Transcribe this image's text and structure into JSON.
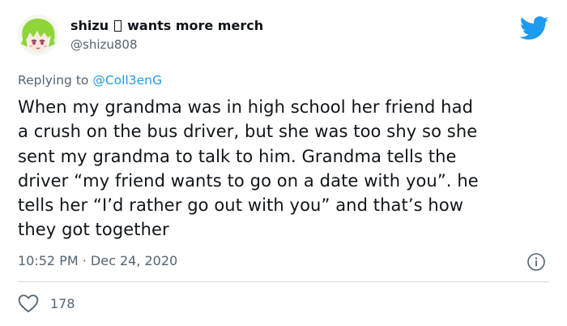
{
  "author": {
    "display_name_part1": "shizu",
    "display_name_part2": "wants more merch",
    "handle": "@shizu808"
  },
  "reply": {
    "prefix": "Replying to",
    "mention": "@Coll3enG"
  },
  "tweet": {
    "lines": [
      "When my grandma was in high school her friend had",
      "a crush on the bus driver, but she was too shy so she",
      "sent my grandma to talk to him. Grandma tells the",
      "driver “my friend wants to go on a date with you”. he",
      "tells her “I’d rather go out with you” and that’s how",
      "they got together"
    ]
  },
  "meta": {
    "timestamp": "10:52 PM · Dec 24, 2020"
  },
  "engagement": {
    "likes": "178"
  },
  "colors": {
    "brand": "#1d9bf0",
    "secondary_text": "#536471",
    "primary_text": "#0f1419",
    "divider": "#cfd9de"
  },
  "icons": {
    "brand": "twitter-bird-icon",
    "info": "info-icon",
    "like": "heart-icon"
  }
}
